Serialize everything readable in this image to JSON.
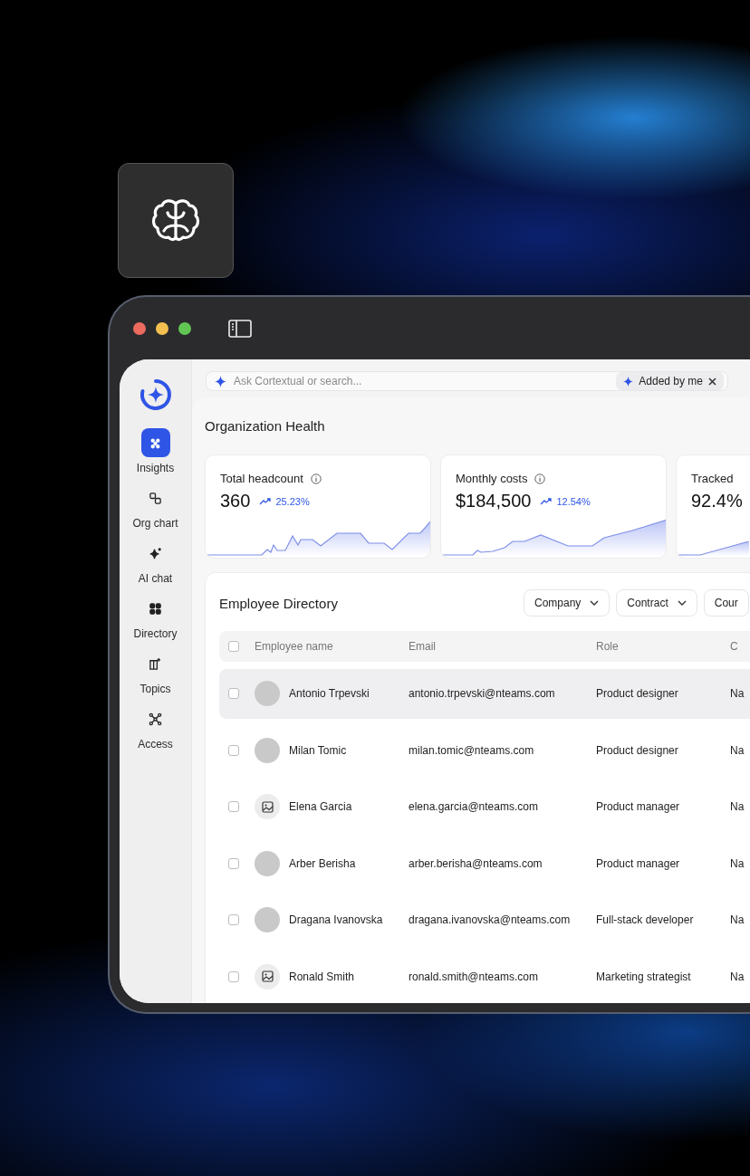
{
  "window": {
    "traffic_lights": [
      {
        "color": "#ec6a5e"
      },
      {
        "color": "#f4bf4f"
      },
      {
        "color": "#61c554"
      }
    ]
  },
  "sidebar": {
    "items": [
      {
        "label": "Insights",
        "selected": true
      },
      {
        "label": "Org chart",
        "selected": false
      },
      {
        "label": "AI chat",
        "selected": false
      },
      {
        "label": "Directory",
        "selected": false
      },
      {
        "label": "Topics",
        "selected": false
      },
      {
        "label": "Access",
        "selected": false
      }
    ]
  },
  "search": {
    "placeholder": "Ask Cortextual or search...",
    "chip": "Added by me"
  },
  "page_title": "Organization Health",
  "stats": [
    {
      "label": "Total headcount",
      "value": "360",
      "change": "25.23%",
      "info": true
    },
    {
      "label": "Monthly costs",
      "value": "$184,500",
      "change": "12.54%",
      "info": true
    },
    {
      "label": "Tracked",
      "value": "92.4%",
      "info": false
    }
  ],
  "directory": {
    "title": "Employee Directory",
    "filters": [
      {
        "label": "Company",
        "caret": true
      },
      {
        "label": "Contract",
        "caret": true
      },
      {
        "label": "Cour",
        "caret": false
      }
    ],
    "columns": [
      "Employee name",
      "Email",
      "Role",
      "C"
    ],
    "header_checked": false,
    "rows": [
      {
        "kind": "photo",
        "name": "Antonio Trpevski",
        "email": "antonio.trpevski@nteams.com",
        "role": "Product designer",
        "column_4": "Na",
        "checked": false,
        "highlighted": true
      },
      {
        "kind": "photo",
        "name": "Milan Tomic",
        "email": "milan.tomic@nteams.com",
        "role": "Product designer",
        "column_4": "Na",
        "checked": false,
        "highlighted": false
      },
      {
        "kind": "placeholder",
        "name": "Elena Garcia",
        "email": "elena.garcia@nteams.com",
        "role": "Product manager",
        "column_4": "Na",
        "checked": false,
        "highlighted": false
      },
      {
        "kind": "photo",
        "name": "Arber Berisha",
        "email": "arber.berisha@nteams.com",
        "role": "Product manager",
        "column_4": "Na",
        "checked": false,
        "highlighted": false
      },
      {
        "kind": "photo",
        "name": "Dragana Ivanovska",
        "email": "dragana.ivanovska@nteams.com",
        "role": "Full-stack developer",
        "column_4": "Na",
        "checked": false,
        "highlighted": false
      },
      {
        "kind": "placeholder",
        "name": "Ronald Smith",
        "email": "ronald.smith@nteams.com",
        "role": "Marketing strategist",
        "column_4": "Na",
        "checked": false,
        "highlighted": false
      }
    ]
  }
}
